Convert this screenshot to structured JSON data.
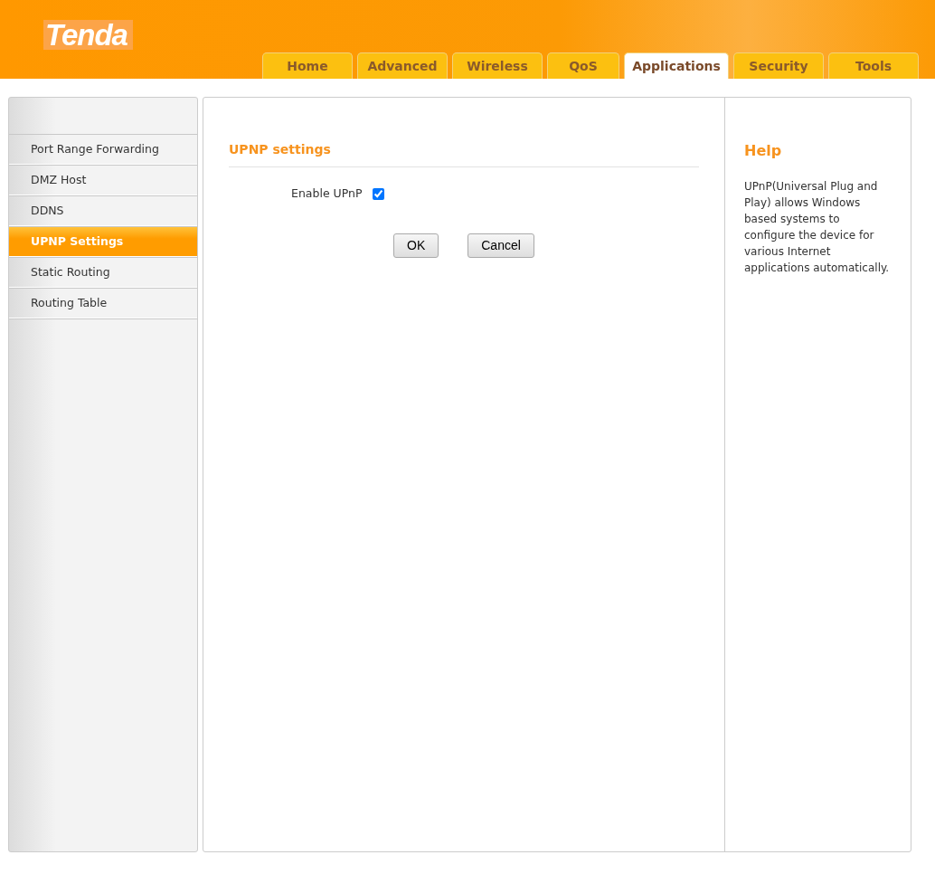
{
  "logo": "Tenda",
  "tabs": [
    {
      "label": "Home",
      "selected": false
    },
    {
      "label": "Advanced",
      "selected": false
    },
    {
      "label": "Wireless",
      "selected": false
    },
    {
      "label": "QoS",
      "selected": false
    },
    {
      "label": "Applications",
      "selected": true
    },
    {
      "label": "Security",
      "selected": false
    },
    {
      "label": "Tools",
      "selected": false
    }
  ],
  "sidebar": {
    "items": [
      {
        "label": "Port Range Forwarding",
        "selected": false
      },
      {
        "label": "DMZ Host",
        "selected": false
      },
      {
        "label": "DDNS",
        "selected": false
      },
      {
        "label": "UPNP Settings",
        "selected": true
      },
      {
        "label": "Static Routing",
        "selected": false
      },
      {
        "label": "Routing Table",
        "selected": false
      }
    ]
  },
  "section_title": "UPNP settings",
  "enable_upnp": {
    "label": "Enable UPnP",
    "checked": true
  },
  "buttons": [
    "OK",
    "Cancel"
  ],
  "help": {
    "title": "Help",
    "text": "UPnP(Universal Plug and Play) allows Windows based systems to configure the device for various Internet applications automatically."
  }
}
